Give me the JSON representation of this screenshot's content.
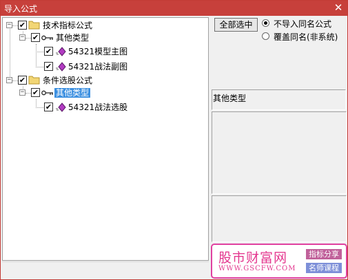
{
  "window": {
    "title": "导入公式",
    "close_glyph": "✕"
  },
  "tree": {
    "nodes": [
      {
        "label": "技术指标公式",
        "expander": "−",
        "checked": "✔",
        "icon": "folder-icon"
      },
      {
        "label": "其他类型",
        "expander": "−",
        "checked": "✔",
        "icon": "key-icon"
      },
      {
        "label": "54321模型主图",
        "checked": "✔",
        "icon": "formula-diamond-icon"
      },
      {
        "label": "54321战法副图",
        "checked": "✔",
        "icon": "formula-diamond-icon"
      },
      {
        "label": "条件选股公式",
        "expander": "−",
        "checked": "✔",
        "icon": "folder-icon"
      },
      {
        "label": "其他类型",
        "expander": "−",
        "checked": "✔",
        "icon": "key-icon",
        "selected": true
      },
      {
        "label": "54321战法选股",
        "checked": "✔",
        "icon": "formula-diamond-icon"
      }
    ]
  },
  "controls": {
    "select_all_label": "全部选中",
    "radio_options": [
      {
        "label": "不导入同名公式",
        "selected": true
      },
      {
        "label": "覆盖同名(非系统)",
        "selected": false
      }
    ]
  },
  "info": {
    "type_label": "其他类型"
  },
  "watermark": {
    "title": "股市财富网",
    "url": "WWW.GSCFW.COM",
    "tag1": "指标分享",
    "tag2": "名师课程",
    "colors": {
      "pink": "#e4388f",
      "tag1_bg": "#c0609a",
      "tag2_bg": "#7d8fd8"
    }
  },
  "colors": {
    "titlebar": "#c7403b",
    "selection": "#3b8fe0"
  }
}
